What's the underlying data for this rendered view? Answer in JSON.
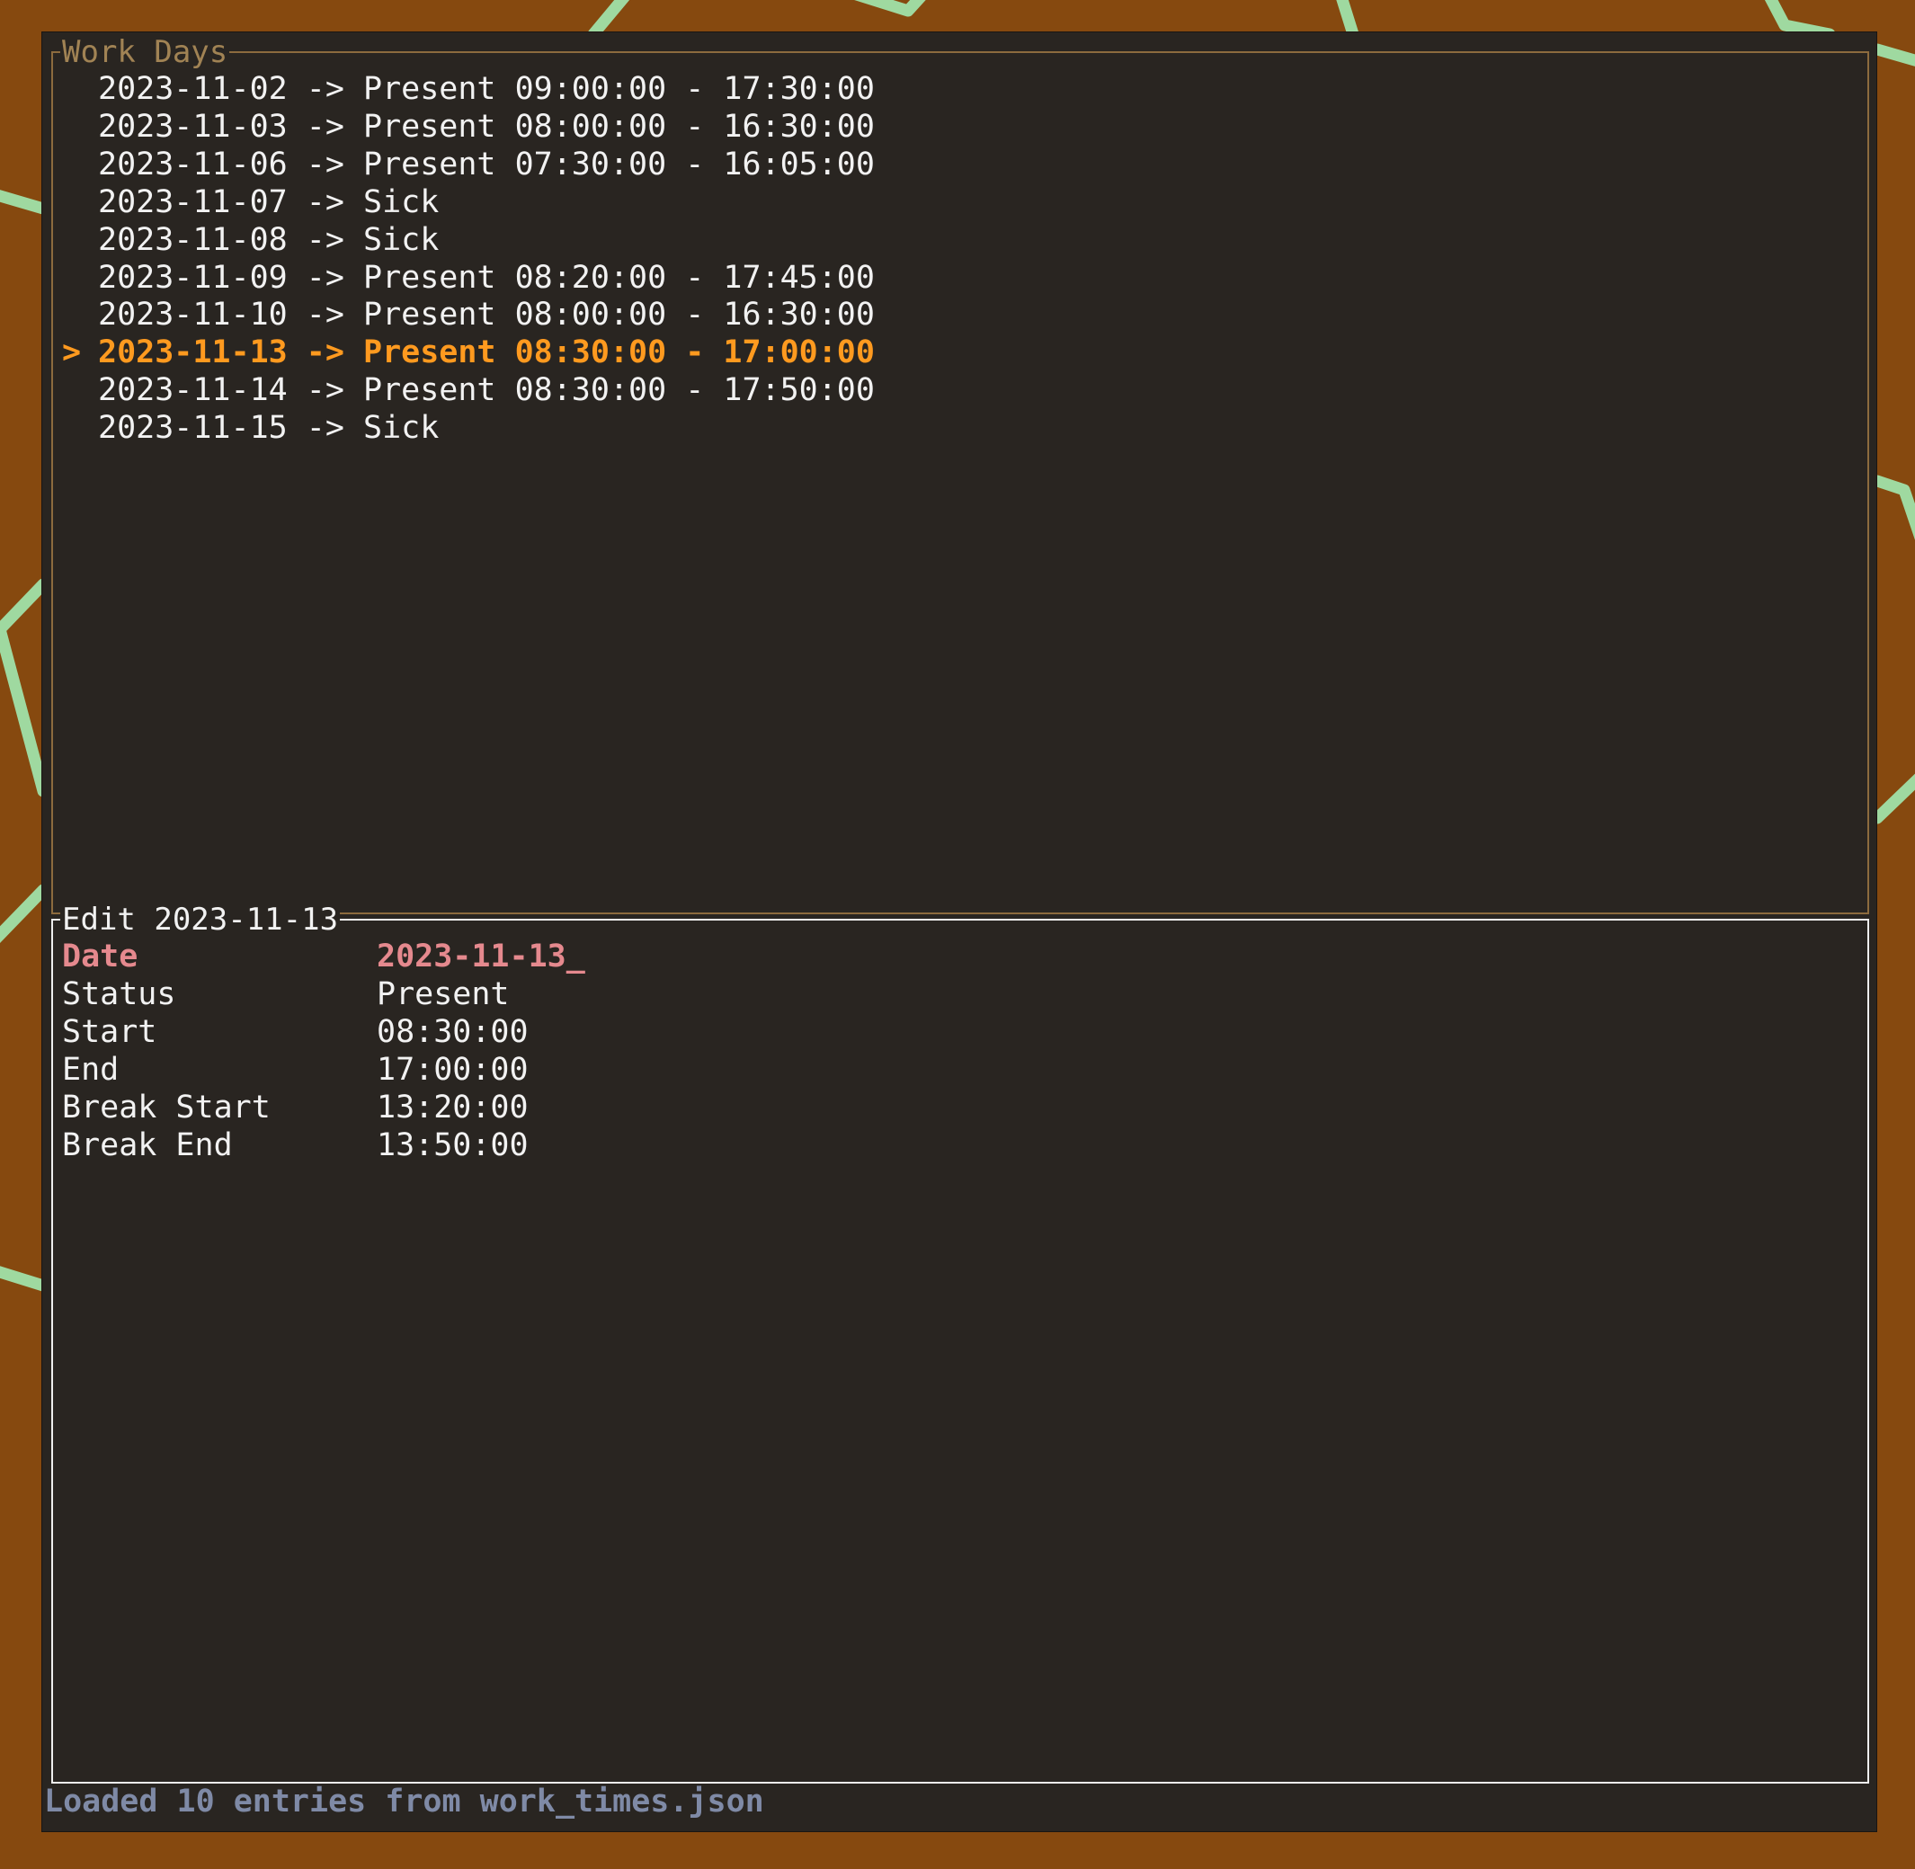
{
  "work_days": {
    "title": "Work Days",
    "selection_marker": ">",
    "rows": [
      {
        "date": "2023-11-02",
        "arrow": "->",
        "status": "Present",
        "start": "09:00:00",
        "end": "17:30:00",
        "selected": false
      },
      {
        "date": "2023-11-03",
        "arrow": "->",
        "status": "Present",
        "start": "08:00:00",
        "end": "16:30:00",
        "selected": false
      },
      {
        "date": "2023-11-06",
        "arrow": "->",
        "status": "Present",
        "start": "07:30:00",
        "end": "16:05:00",
        "selected": false
      },
      {
        "date": "2023-11-07",
        "arrow": "->",
        "status": "Sick",
        "start": "",
        "end": "",
        "selected": false
      },
      {
        "date": "2023-11-08",
        "arrow": "->",
        "status": "Sick",
        "start": "",
        "end": "",
        "selected": false
      },
      {
        "date": "2023-11-09",
        "arrow": "->",
        "status": "Present",
        "start": "08:20:00",
        "end": "17:45:00",
        "selected": false
      },
      {
        "date": "2023-11-10",
        "arrow": "->",
        "status": "Present",
        "start": "08:00:00",
        "end": "16:30:00",
        "selected": false
      },
      {
        "date": "2023-11-13",
        "arrow": "->",
        "status": "Present",
        "start": "08:30:00",
        "end": "17:00:00",
        "selected": true
      },
      {
        "date": "2023-11-14",
        "arrow": "->",
        "status": "Present",
        "start": "08:30:00",
        "end": "17:50:00",
        "selected": false
      },
      {
        "date": "2023-11-15",
        "arrow": "->",
        "status": "Sick",
        "start": "",
        "end": "",
        "selected": false
      }
    ]
  },
  "editor": {
    "title": "Edit 2023-11-13",
    "fields": [
      {
        "label": "Date",
        "value": "2023-11-13_",
        "active": true
      },
      {
        "label": "Status",
        "value": "Present",
        "active": false
      },
      {
        "label": "Start",
        "value": "08:30:00",
        "active": false
      },
      {
        "label": "End",
        "value": "17:00:00",
        "active": false
      },
      {
        "label": "Break Start",
        "value": "13:20:00",
        "active": false
      },
      {
        "label": "Break End",
        "value": "13:50:00",
        "active": false
      }
    ]
  },
  "status_bar": {
    "message": "Loaded 10 entries from work_times.json"
  },
  "colors": {
    "desktop_background": "#86490f",
    "background_lines": "#9fd9a0",
    "terminal_background": "#292521",
    "selected_row": "#ff9a1f",
    "active_field": "#e5898e",
    "status_text": "#7f8aa6",
    "work_days_border": "#8c6b3e",
    "editor_border": "#eeeeee"
  }
}
